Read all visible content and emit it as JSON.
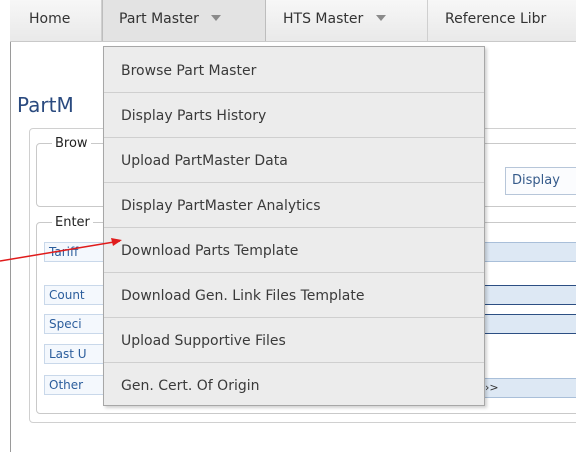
{
  "menubar": {
    "items": [
      {
        "label": "Home",
        "has_dropdown": false
      },
      {
        "label": "Part Master",
        "has_dropdown": true,
        "active": true
      },
      {
        "label": "HTS Master",
        "has_dropdown": true
      },
      {
        "label": "Reference Libr",
        "has_dropdown": false
      }
    ]
  },
  "page": {
    "title": "PartM",
    "browse_legend": "Brow",
    "display_button": "Display",
    "enter_legend": "Enter",
    "rows": [
      "Tariff",
      "Count",
      "Speci",
      "Last U",
      "Other"
    ],
    "other_value": "›>"
  },
  "dropdown": {
    "items": [
      "Browse Part Master",
      "Display Parts History",
      "Upload PartMaster Data",
      "Display PartMaster Analytics",
      "Download Parts Template",
      "Download Gen. Link Files Template",
      "Upload Supportive Files",
      "Gen. Cert. Of Origin"
    ]
  },
  "colors": {
    "accent": "#2a4a7f",
    "annotation_arrow": "#e01b1b"
  }
}
